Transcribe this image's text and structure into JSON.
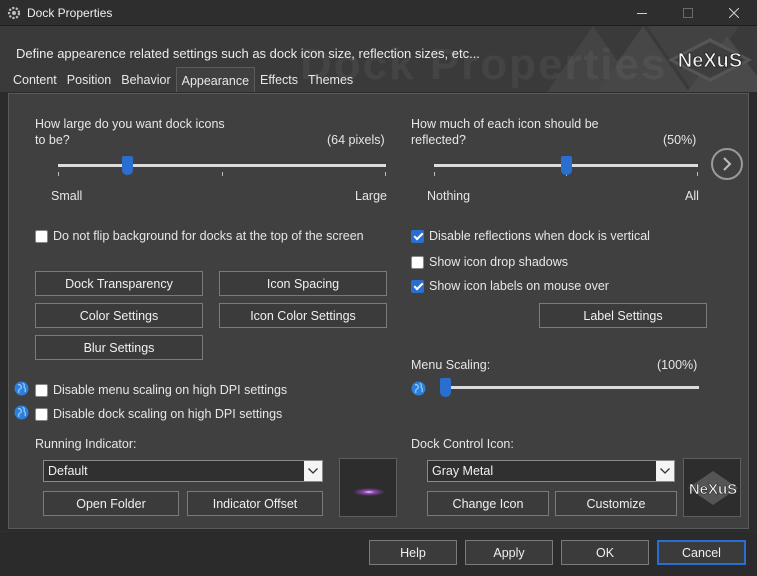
{
  "window": {
    "title": "Dock Properties"
  },
  "banner": {
    "description": "Define appearence related settings such as dock icon size, reflection sizes, etc...",
    "watermark": "Dock Properties",
    "logo": "NeXuS"
  },
  "tabs": [
    {
      "label": "Content"
    },
    {
      "label": "Position"
    },
    {
      "label": "Behavior"
    },
    {
      "label": "Appearance",
      "active": true
    },
    {
      "label": "Effects"
    },
    {
      "label": "Themes"
    }
  ],
  "icon_size": {
    "question_line1": "How large do you want dock icons",
    "question_line2": "to be?",
    "value_text": "(64 pixels)",
    "min_label": "Small",
    "max_label": "Large",
    "level": 0.21
  },
  "reflection": {
    "question_line1": "How much of each icon should be",
    "question_line2": "reflected?",
    "value_text": "(50%)",
    "min_label": "Nothing",
    "max_label": "All",
    "level": 0.5
  },
  "checkboxes": {
    "no_flip": {
      "label": "Do not flip background for docks at the top of the screen",
      "checked": false
    },
    "disable_reflections": {
      "label": "Disable reflections when dock is vertical",
      "checked": true
    },
    "drop_shadows": {
      "label": "Show icon drop shadows",
      "checked": false
    },
    "icon_labels": {
      "label": "Show icon labels on mouse over",
      "checked": true
    },
    "menu_dpi": {
      "label": "Disable menu scaling on high DPI settings",
      "checked": false
    },
    "dock_dpi": {
      "label": "Disable dock scaling on high DPI settings",
      "checked": false
    }
  },
  "buttons": {
    "dock_transparency": "Dock Transparency",
    "icon_spacing": "Icon Spacing",
    "color_settings": "Color Settings",
    "icon_color_settings": "Icon Color Settings",
    "blur_settings": "Blur Settings",
    "label_settings": "Label Settings",
    "open_folder": "Open Folder",
    "indicator_offset": "Indicator Offset",
    "change_icon": "Change Icon",
    "customize": "Customize"
  },
  "menu_scaling": {
    "label": "Menu Scaling:",
    "value_text": "(100%)",
    "level": 0.0
  },
  "running_indicator": {
    "label": "Running Indicator:",
    "selected": "Default"
  },
  "dock_control_icon": {
    "label": "Dock Control Icon:",
    "selected": "Gray Metal",
    "preview_logo": "NeXuS"
  },
  "footer": {
    "help": "Help",
    "apply": "Apply",
    "ok": "OK",
    "cancel": "Cancel"
  },
  "colors": {
    "accent": "#2a6fd0",
    "panel": "#404040",
    "background": "#2b2b2b"
  }
}
